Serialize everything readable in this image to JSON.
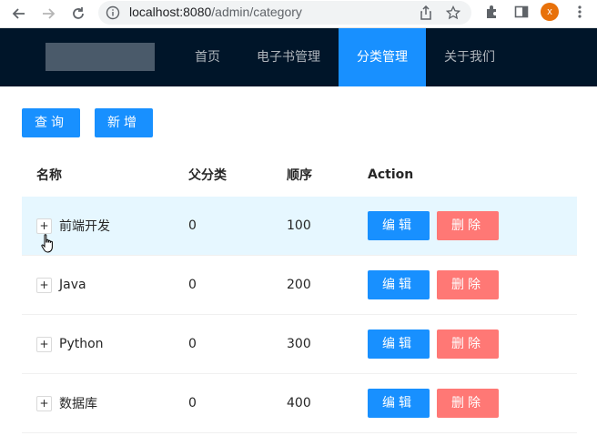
{
  "browser": {
    "url_host": "localhost:8080",
    "url_path": "/admin/category",
    "profile_initial": "x"
  },
  "header": {
    "menu": [
      {
        "label": "首页",
        "active": false
      },
      {
        "label": "电子书管理",
        "active": false
      },
      {
        "label": "分类管理",
        "active": true
      },
      {
        "label": "关于我们",
        "active": false
      }
    ]
  },
  "toolbar": {
    "query_label": "查询",
    "add_label": "新增"
  },
  "table": {
    "columns": [
      "名称",
      "父分类",
      "顺序",
      "Action"
    ],
    "rows": [
      {
        "name": "前端开发",
        "parent": "0",
        "sort": "100",
        "edit": "编辑",
        "delete": "删除"
      },
      {
        "name": "Java",
        "parent": "0",
        "sort": "200",
        "edit": "编辑",
        "delete": "删除"
      },
      {
        "name": "Python",
        "parent": "0",
        "sort": "300",
        "edit": "编辑",
        "delete": "删除"
      },
      {
        "name": "数据库",
        "parent": "0",
        "sort": "400",
        "edit": "编辑",
        "delete": "删除"
      }
    ]
  },
  "colors": {
    "header_bg": "#001529",
    "primary": "#1890ff",
    "danger": "#ff7875",
    "row_hover": "#e6f7ff"
  }
}
